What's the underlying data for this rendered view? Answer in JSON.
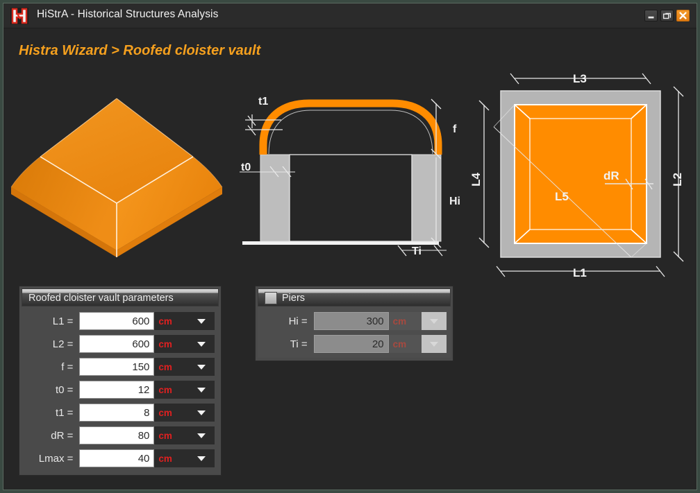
{
  "window": {
    "title": "HiStrA - Historical Structures Analysis",
    "logo_icon": "histra-h-logo-icon",
    "controls": {
      "minimize_icon": "minimize-icon",
      "restore_icon": "restore-icon",
      "close_icon": "close-icon"
    },
    "background_color": "#262626",
    "border_color": "#5a6a60"
  },
  "breadcrumb": {
    "text": "Histra Wizard > Roofed cloister vault",
    "color": "#f5a01e"
  },
  "figures": {
    "isometric": {
      "name": "roofed-cloister-vault-3d-view",
      "fill_color": "#ef8a16",
      "top_face_color": "#f08a18",
      "left_face_color": "#e07c0c",
      "right_face_color": "#f59320"
    },
    "elevation": {
      "name": "vault-elevation-section",
      "vault_color": "#ff8c00",
      "pier_color": "#bfbfbf",
      "labels": [
        {
          "key": "t1",
          "text": "t1"
        },
        {
          "key": "t0",
          "text": "t0"
        },
        {
          "key": "f",
          "text": "f"
        },
        {
          "key": "Hi",
          "text": "Hi"
        },
        {
          "key": "Ti",
          "text": "Ti"
        }
      ]
    },
    "plan": {
      "name": "vault-plan-view",
      "vault_color": "#ff8c00",
      "pier_color": "#b5b5b5",
      "labels": [
        {
          "key": "L3",
          "text": "L3"
        },
        {
          "key": "L4",
          "text": "L4"
        },
        {
          "key": "L2",
          "text": "L2"
        },
        {
          "key": "L1",
          "text": "L1"
        },
        {
          "key": "L5",
          "text": "L5"
        },
        {
          "key": "dR",
          "text": "dR"
        }
      ]
    }
  },
  "panels": {
    "parameters": {
      "title": "Roofed cloister vault parameters",
      "rows": [
        {
          "label": "L1 =",
          "value": "600",
          "unit": "cm",
          "enabled": true
        },
        {
          "label": "L2 =",
          "value": "600",
          "unit": "cm",
          "enabled": true
        },
        {
          "label": "f =",
          "value": "150",
          "unit": "cm",
          "enabled": true
        },
        {
          "label": "t0 =",
          "value": "12",
          "unit": "cm",
          "enabled": true
        },
        {
          "label": "t1 =",
          "value": "8",
          "unit": "cm",
          "enabled": true
        },
        {
          "label": "dR =",
          "value": "80",
          "unit": "cm",
          "enabled": true
        },
        {
          "label": "Lmax =",
          "value": "40",
          "unit": "cm",
          "enabled": true
        }
      ]
    },
    "piers": {
      "title": "Piers",
      "checkbox_checked": false,
      "rows": [
        {
          "label": "Hi =",
          "value": "300",
          "unit": "cm",
          "enabled": false
        },
        {
          "label": "Ti =",
          "value": "20",
          "unit": "cm",
          "enabled": false
        }
      ]
    }
  },
  "colors": {
    "accent": "#f5a01e",
    "unit_red": "#e02020",
    "vault_orange": "#ff8c00"
  }
}
